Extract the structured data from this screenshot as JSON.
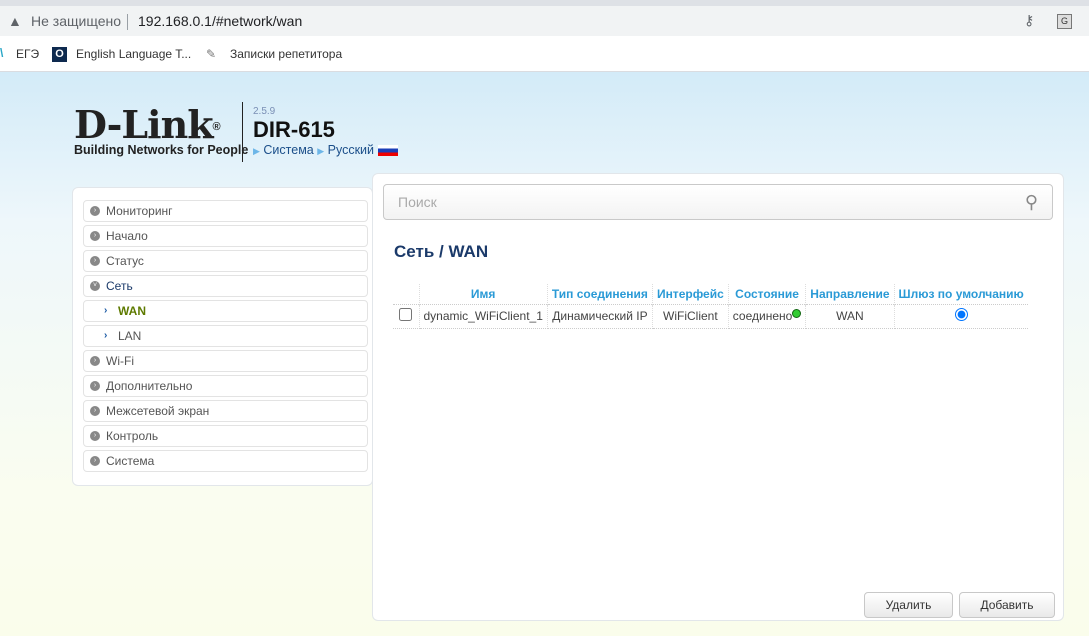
{
  "browser": {
    "security": "Не защищено",
    "url": "192.168.0.1/#network/wan",
    "bookmarks": [
      {
        "label": "ЕГЭ"
      },
      {
        "label": "English Language T..."
      },
      {
        "label": "Записки репетитора"
      }
    ]
  },
  "header": {
    "brand": "D-Link",
    "tagline": "Building Networks for People",
    "version": "2.5.9",
    "model": "DIR-615",
    "crumb_system": "Система",
    "crumb_lang": "Русский"
  },
  "menu": [
    {
      "label": "Мониторинг"
    },
    {
      "label": "Начало"
    },
    {
      "label": "Статус"
    },
    {
      "label": "Сеть"
    },
    {
      "label": "WAN"
    },
    {
      "label": "LAN"
    },
    {
      "label": "Wi-Fi"
    },
    {
      "label": "Дополнительно"
    },
    {
      "label": "Межсетевой экран"
    },
    {
      "label": "Контроль"
    },
    {
      "label": "Система"
    }
  ],
  "main": {
    "search_placeholder": "Поиск",
    "title": "Сеть /  WAN",
    "columns": [
      "Имя",
      "Тип соединения",
      "Интерфейс",
      "Состояние",
      "Направление",
      "Шлюз по умолчанию"
    ],
    "rows": [
      {
        "name": "dynamic_WiFiClient_1",
        "type": "Динамический IP",
        "iface": "WiFiClient",
        "state": "соединено",
        "direction": "WAN",
        "default_gw": true
      }
    ],
    "delete_label": "Удалить",
    "add_label": "Добавить"
  },
  "colors": {
    "accent": "#2a9ad6",
    "title": "#1b3a6a",
    "active": "#5e7a00"
  }
}
